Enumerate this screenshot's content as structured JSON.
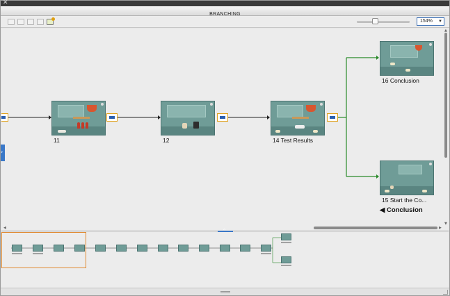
{
  "window": {
    "title": "BRANCHING"
  },
  "toolbar": {
    "icons": [
      "select-icon",
      "copy-slide-icon",
      "paste-slide-icon",
      "group-icon",
      "highlight-icon"
    ],
    "zoom_value": "154%"
  },
  "canvas": {
    "slides": [
      {
        "id": "slide-11",
        "label": "11"
      },
      {
        "id": "slide-12",
        "label": "12"
      },
      {
        "id": "slide-14",
        "label": "14  Test Results"
      },
      {
        "id": "slide-16",
        "label": "16  Conclusion"
      },
      {
        "id": "slide-15",
        "label": "15  Start the Co..."
      }
    ],
    "branch_label": "Conclusion",
    "branch_label_icon": "◀"
  },
  "colors": {
    "accent": "#3a78c8",
    "connector_border": "#e0a018",
    "branch_line": "#2a8a2a",
    "slide_bg": "#6f9c97"
  }
}
